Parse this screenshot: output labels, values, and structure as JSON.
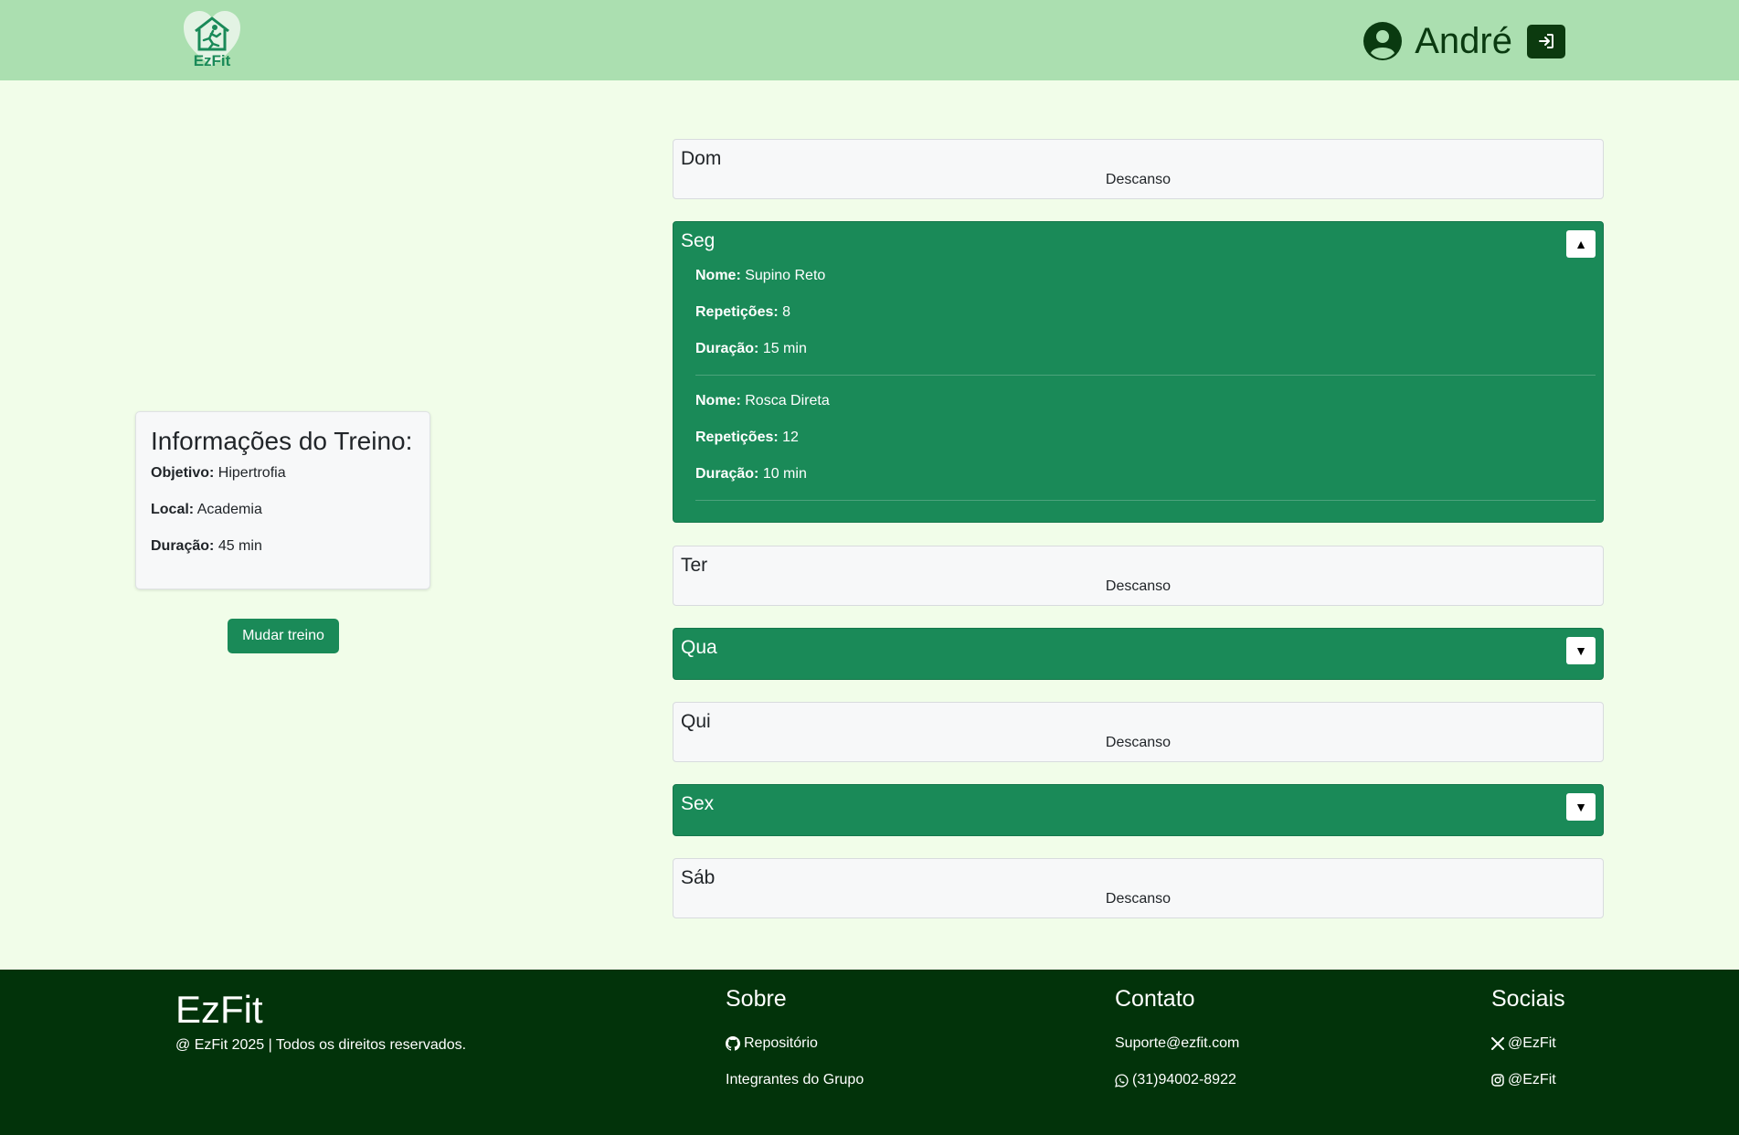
{
  "header": {
    "logo_text": "EzFit",
    "user_name": "André"
  },
  "info_card": {
    "title": "Informações do Treino:",
    "objective_label": "Objetivo:",
    "objective_value": "Hipertrofia",
    "location_label": "Local:",
    "location_value": "Academia",
    "duration_label": "Duração:",
    "duration_value": "45 min"
  },
  "change_button": "Mudar treino",
  "days": [
    {
      "name": "Dom",
      "rest": "Descanso"
    },
    {
      "name": "Seg",
      "toggle": "▲",
      "exercises": [
        {
          "name_label": "Nome:",
          "name": "Supino Reto",
          "reps_label": "Repetições:",
          "reps": "8",
          "dur_label": "Duração:",
          "dur": "15 min"
        },
        {
          "name_label": "Nome:",
          "name": "Rosca Direta",
          "reps_label": "Repetições:",
          "reps": "12",
          "dur_label": "Duração:",
          "dur": "10 min"
        }
      ]
    },
    {
      "name": "Ter",
      "rest": "Descanso"
    },
    {
      "name": "Qua",
      "toggle": "▼"
    },
    {
      "name": "Qui",
      "rest": "Descanso"
    },
    {
      "name": "Sex",
      "toggle": "▼"
    },
    {
      "name": "Sáb",
      "rest": "Descanso"
    }
  ],
  "footer": {
    "brand": "EzFit",
    "copyright": "@ EzFit 2025 | Todos os direitos reservados.",
    "about_title": "Sobre",
    "about_links": [
      "Repositório",
      "Integrantes do Grupo"
    ],
    "contact_title": "Contato",
    "contact_email": "Suporte@ezfit.com",
    "contact_phone": "(31)94002-8922",
    "social_title": "Sociais",
    "social_x": "@EzFit",
    "social_instagram": "@EzFit"
  },
  "colors": {
    "header_bg": "#abdfb0",
    "page_bg": "#f1fde9",
    "accent": "#1a8a58",
    "footer_bg": "#02330a"
  }
}
